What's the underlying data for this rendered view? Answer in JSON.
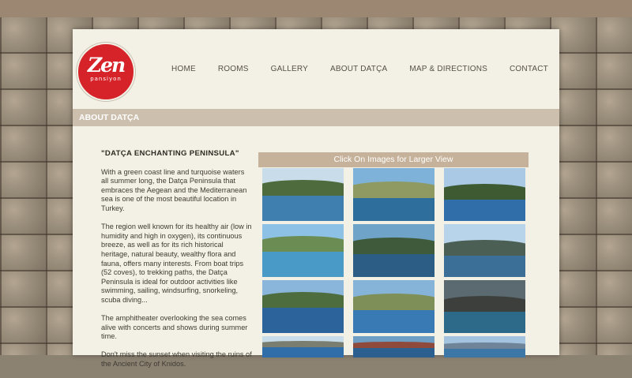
{
  "logo": {
    "main": "Zen",
    "sub": "pansiyon"
  },
  "nav": [
    "HOME",
    "ROOMS",
    "GALLERY",
    "ABOUT DATÇA",
    "MAP & DIRECTIONS",
    "CONTACT"
  ],
  "section_title": "ABOUT DATÇA",
  "article": {
    "heading": "\"DATÇA ENCHANTING PENINSULA\"",
    "paragraphs": [
      "With a green coast line and turquoise waters all summer long, the Datça Peninsula that embraces the Aegean and the Mediterranean sea is one of the most beautiful location in Turkey.",
      "The region well known for its healthy air (low in humidity and high in oxygen), its continuous breeze, as well as for its rich historical heritage, natural beauty, wealthy flora and fauna, offers many interests. From boat trips (52 coves), to trekking paths, the Datça Peninsula is ideal for outdoor activities like swimming, sailing, windsurfing, snorkeling, scuba diving...",
      "The amphitheater overlooking the sea comes alive with concerts and shows during summer time.",
      "Don't miss the sunset when visiting the ruins of the Ancient City of Knidos."
    ]
  },
  "gallery": {
    "heading": "Click On Images for Larger View",
    "thumbs": [
      {
        "sky": "#c9dcea",
        "hill": "#4d6b3c",
        "sea": "#3f7fb0"
      },
      {
        "sky": "#7fb2d8",
        "hill": "#8e9a62",
        "sea": "#2d6e9c"
      },
      {
        "sky": "#a9c9e4",
        "hill": "#3e5a33",
        "sea": "#2f6ea8"
      },
      {
        "sky": "#8ec1e6",
        "hill": "#6b8d54",
        "sea": "#4a9ac8"
      },
      {
        "sky": "#6fa3c8",
        "hill": "#3f5a3a",
        "sea": "#2b5d85"
      },
      {
        "sky": "#b8d4ea",
        "hill": "#4b5f55",
        "sea": "#3c6f98"
      },
      {
        "sky": "#8ab6dc",
        "hill": "#4e6d3e",
        "sea": "#2c639a"
      },
      {
        "sky": "#86b4d8",
        "hill": "#7f8f58",
        "sea": "#3a7ab4"
      },
      {
        "sky": "#5b6a70",
        "hill": "#3c3f3b",
        "sea": "#2d6a8a"
      },
      {
        "sky": "#c9dcea",
        "hill": "#7a7e70",
        "sea": "#2f6ea8"
      },
      {
        "sky": "#6f9ec4",
        "hill": "#8f4a3c",
        "sea": "#2a5f8f"
      },
      {
        "sky": "#a3c3df",
        "hill": "#6f8499",
        "sea": "#3c77a8"
      }
    ]
  }
}
